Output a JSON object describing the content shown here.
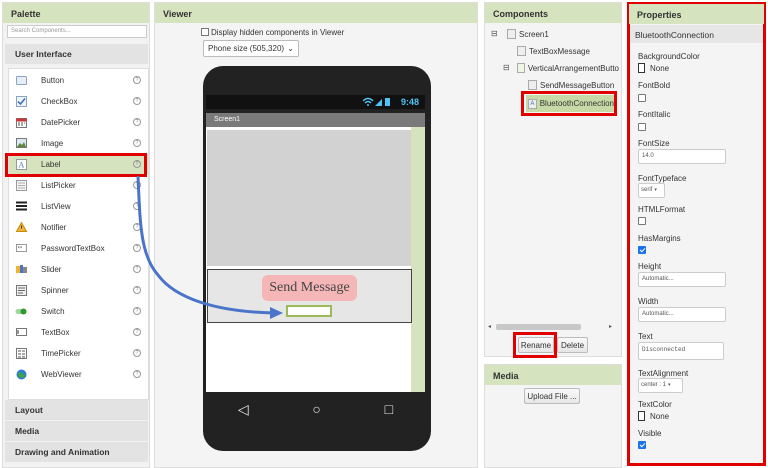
{
  "palette": {
    "title": "Palette",
    "search_placeholder": "Search Components...",
    "section_ui": "User Interface",
    "items": [
      {
        "label": "Button",
        "icon": "button-icon"
      },
      {
        "label": "CheckBox",
        "icon": "checkbox-icon"
      },
      {
        "label": "DatePicker",
        "icon": "datepicker-icon"
      },
      {
        "label": "Image",
        "icon": "image-icon"
      },
      {
        "label": "Label",
        "icon": "label-icon"
      },
      {
        "label": "ListPicker",
        "icon": "listpicker-icon"
      },
      {
        "label": "ListView",
        "icon": "listview-icon"
      },
      {
        "label": "Notifier",
        "icon": "notifier-icon"
      },
      {
        "label": "PasswordTextBox",
        "icon": "password-icon"
      },
      {
        "label": "Slider",
        "icon": "slider-icon"
      },
      {
        "label": "Spinner",
        "icon": "spinner-icon"
      },
      {
        "label": "Switch",
        "icon": "switch-icon"
      },
      {
        "label": "TextBox",
        "icon": "textbox-icon"
      },
      {
        "label": "TimePicker",
        "icon": "timepicker-icon"
      },
      {
        "label": "WebViewer",
        "icon": "webviewer-icon"
      }
    ],
    "help_glyph": "?",
    "section_layout": "Layout",
    "section_media": "Media",
    "section_drawing": "Drawing and Animation"
  },
  "viewer": {
    "title": "Viewer",
    "hidden_components_label": "Display hidden components in Viewer",
    "phone_size": "Phone size (505,320)",
    "status_time": "9:48",
    "screen_title": "Screen1",
    "send_button_label": "Send Message",
    "nav_back": "◁",
    "nav_home": "○",
    "nav_recent": "□"
  },
  "components": {
    "title": "Components",
    "tree": [
      {
        "label": "Screen1",
        "icon": "screen-icon"
      },
      {
        "label": "TextBoxMessage",
        "icon": "textbox-icon"
      },
      {
        "label": "VerticalArrangementButto",
        "icon": "arrangement-icon"
      },
      {
        "label": "SendMessageButton",
        "icon": "button-icon"
      },
      {
        "label": "BluetoothConnection",
        "icon": "label-icon"
      }
    ],
    "collapse_glyph": "⊟",
    "rename_label": "Rename",
    "delete_label": "Delete"
  },
  "media": {
    "title": "Media",
    "upload_label": "Upload File ..."
  },
  "properties": {
    "title": "Properties",
    "component_name": "BluetoothConnection",
    "background_color_label": "BackgroundColor",
    "background_color_value": "None",
    "font_bold_label": "FontBold",
    "font_bold_checked": false,
    "font_italic_label": "FontItalic",
    "font_italic_checked": false,
    "font_size_label": "FontSize",
    "font_size_value": "14.0",
    "font_typeface_label": "FontTypeface",
    "font_typeface_value": "serif",
    "html_format_label": "HTMLFormat",
    "html_format_checked": false,
    "has_margins_label": "HasMargins",
    "has_margins_checked": true,
    "height_label": "Height",
    "height_value": "Automatic...",
    "width_label": "Width",
    "width_value": "Automatic...",
    "text_label": "Text",
    "text_value": "Disconnected",
    "text_alignment_label": "TextAlignment",
    "text_alignment_value": "center : 1",
    "text_color_label": "TextColor",
    "text_color_value": "None",
    "visible_label": "Visible",
    "visible_checked": true
  },
  "colors": {
    "header_green": "#d6e3bf",
    "highlight_red": "#e00000",
    "send_button_bg": "#f4b6b6",
    "drag_arrow": "#4a74c9"
  }
}
